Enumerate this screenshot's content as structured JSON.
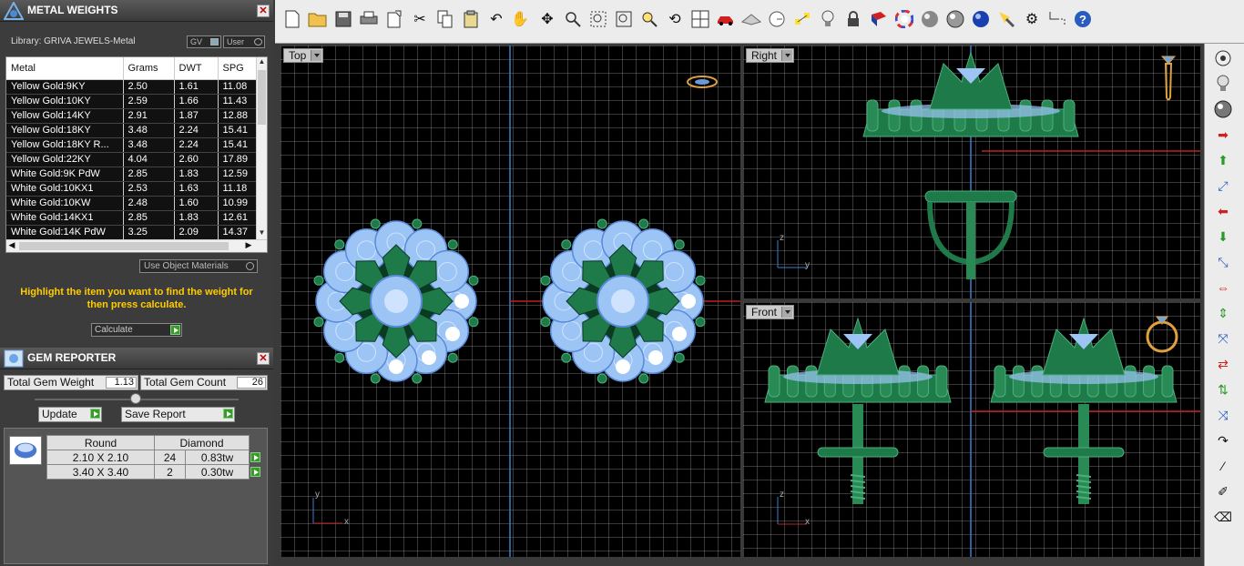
{
  "metal_weights": {
    "title": "METAL WEIGHTS",
    "library_label": "Library: GRIVA JEWELS-Metal",
    "toggle_gv": "GV",
    "toggle_user": "User",
    "columns": [
      "Metal",
      "Grams",
      "DWT",
      "SPG"
    ],
    "rows": [
      [
        "Yellow Gold:9KY",
        "2.50",
        "1.61",
        "11.08"
      ],
      [
        "Yellow Gold:10KY",
        "2.59",
        "1.66",
        "11.43"
      ],
      [
        "Yellow Gold:14KY",
        "2.91",
        "1.87",
        "12.88"
      ],
      [
        "Yellow Gold:18KY",
        "3.48",
        "2.24",
        "15.41"
      ],
      [
        "Yellow Gold:18KY R...",
        "3.48",
        "2.24",
        "15.41"
      ],
      [
        "Yellow Gold:22KY",
        "4.04",
        "2.60",
        "17.89"
      ],
      [
        "White Gold:9K PdW",
        "2.85",
        "1.83",
        "12.59"
      ],
      [
        "White Gold:10KX1",
        "2.53",
        "1.63",
        "11.18"
      ],
      [
        "White Gold:10KW",
        "2.48",
        "1.60",
        "10.99"
      ],
      [
        "White Gold:14KX1",
        "2.85",
        "1.83",
        "12.61"
      ],
      [
        "White Gold:14K PdW",
        "3.25",
        "2.09",
        "14.37"
      ]
    ],
    "use_object_materials": "Use Object Materials",
    "instructions": "Highlight the item you want to find the weight for then press calculate.",
    "calculate_label": "Calculate"
  },
  "gem_reporter": {
    "title": "GEM REPORTER",
    "total_weight_label": "Total Gem Weight",
    "total_weight_value": "1.13",
    "total_count_label": "Total Gem Count",
    "total_count_value": "26",
    "update_label": "Update",
    "save_report_label": "Save Report",
    "shape_header": "Round",
    "type_header": "Diamond",
    "gems": [
      {
        "size": "2.10 X 2.10",
        "count": "24",
        "weight": "0.83tw"
      },
      {
        "size": "3.40 X 3.40",
        "count": "2",
        "weight": "0.30tw"
      }
    ]
  },
  "viewports": {
    "top": "Top",
    "right": "Right",
    "front": "Front",
    "axis_y": "y",
    "axis_x": "x",
    "axis_z": "z"
  },
  "colors": {
    "gem": "#9cc4f5",
    "metal": "#1f7a4a",
    "grid_axis_blue": "#3a7fd0",
    "grid_axis_red": "#c02020"
  }
}
